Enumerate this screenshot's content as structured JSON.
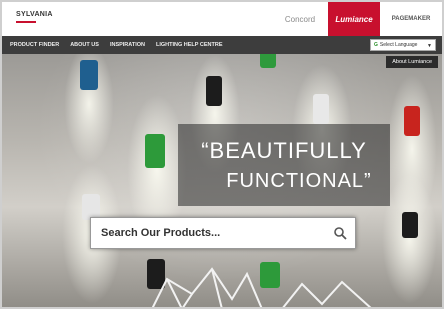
{
  "brand": {
    "logo": "SYLVANIA"
  },
  "tabs": [
    {
      "label": "Concord"
    },
    {
      "label": "Lumiance"
    },
    {
      "label": "PAGEMAKER"
    }
  ],
  "nav": {
    "items": [
      "PRODUCT FINDER",
      "ABOUT US",
      "INSPIRATION",
      "LIGHTING HELP CENTRE"
    ],
    "language": "Select Language"
  },
  "hero": {
    "about_button": "About Lumiance",
    "quote_line1": "“BEAUTIFULLY",
    "quote_line2": "FUNCTIONAL”"
  },
  "search": {
    "placeholder": "Search Our Products..."
  },
  "colors": {
    "brand_red": "#c8102e",
    "nav_dark": "#3d3d3d"
  }
}
